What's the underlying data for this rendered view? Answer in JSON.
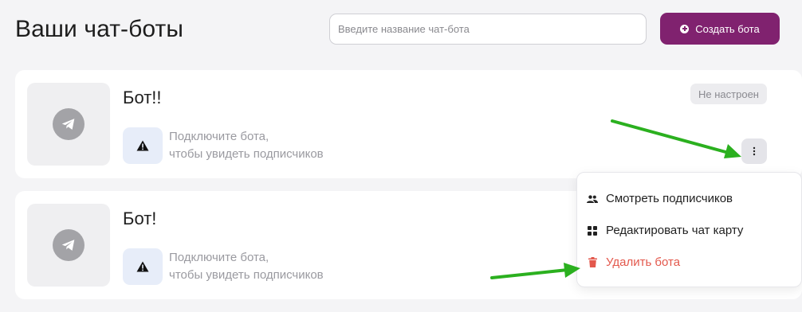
{
  "header": {
    "title": "Ваши чат-боты",
    "search_placeholder": "Введите название чат-бота",
    "create_button_label": "Создать бота"
  },
  "bots": [
    {
      "name": "Бот!!",
      "status": "Не настроен",
      "hint_line1": "Подключите бота,",
      "hint_line2": "чтобы увидеть подписчиков"
    },
    {
      "name": "Бот!",
      "hint_line1": "Подключите бота,",
      "hint_line2": "чтобы увидеть подписчиков"
    }
  ],
  "menu": {
    "items": [
      {
        "label": "Смотреть подписчиков",
        "icon": "people-icon"
      },
      {
        "label": "Редактировать чат карту",
        "icon": "grid-icon"
      },
      {
        "label": "Удалить бота",
        "icon": "trash-icon"
      }
    ]
  },
  "colors": {
    "accent": "#80226f",
    "danger": "#e3584c",
    "arrow": "#2bb01f",
    "background": "#f4f4f6"
  }
}
